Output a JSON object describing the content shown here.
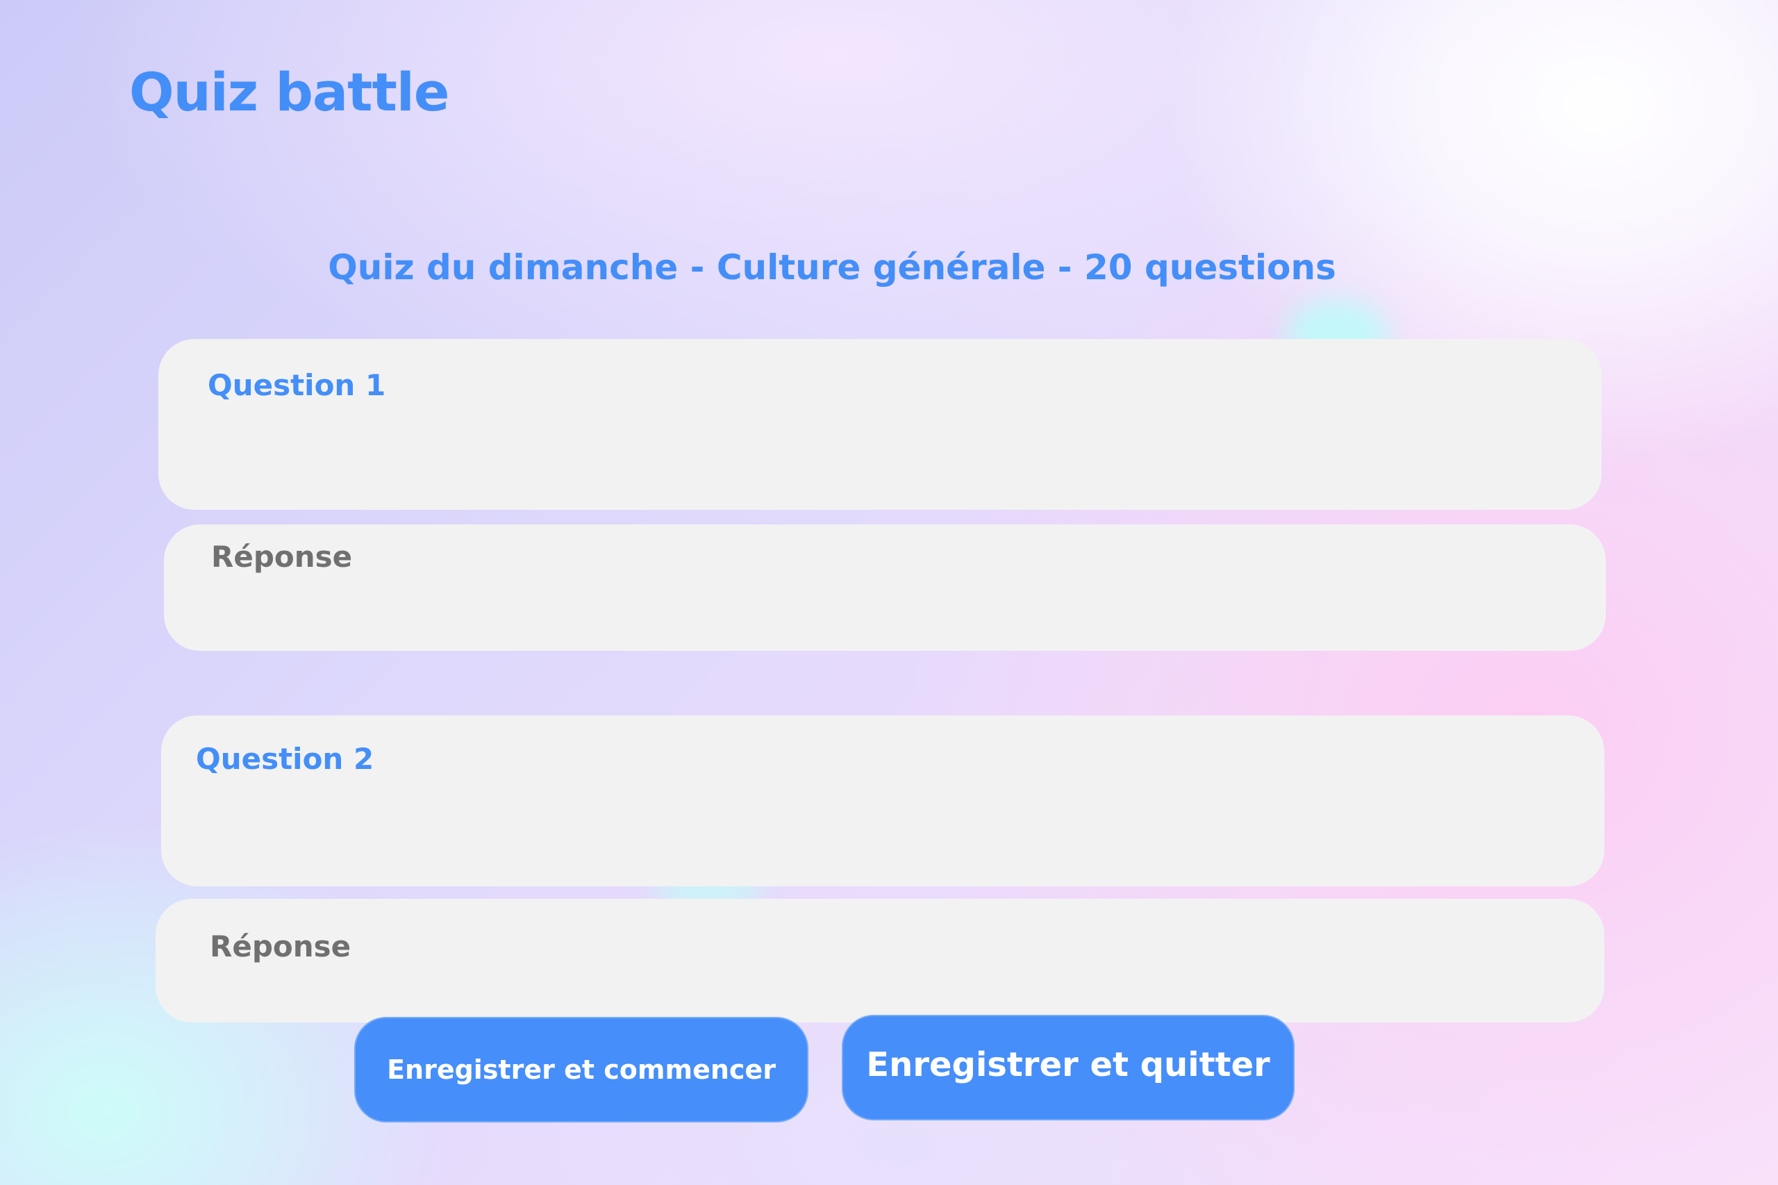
{
  "app": {
    "title": "Quiz battle"
  },
  "quiz": {
    "subtitle": "Quiz du dimanche - Culture générale - 20 questions"
  },
  "fields": [
    {
      "question_label": "Question 1",
      "answer_label": "Réponse"
    },
    {
      "question_label": "Question 2",
      "answer_label": "Réponse"
    }
  ],
  "actions": {
    "save_and_start": "Enregistrer et commencer",
    "save_and_quit": "Enregistrer et quitter"
  },
  "colors": {
    "accent": "#448ef8",
    "button": "#468ef9",
    "field_background": "#f2f2f2",
    "answer_label": "#707070"
  }
}
